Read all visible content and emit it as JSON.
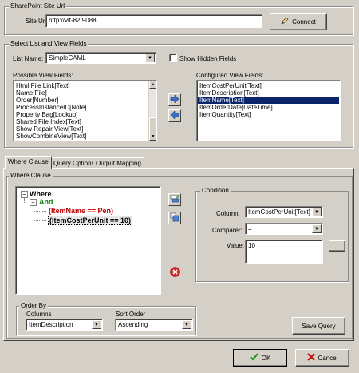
{
  "site_group": {
    "legend": "SharePoint Site Url",
    "site_url_label": "Site Url:",
    "site_url_value": "http://vlt-82:9088",
    "connect_label": "Connect"
  },
  "select_group": {
    "legend": "Select List and View Fields",
    "list_name_label": "List Name:",
    "list_name_value": "SimpleCAML",
    "show_hidden_label": "Show Hidden Fields",
    "possible_label": "Possible View Fields:",
    "configured_label": "Configured View Fields:",
    "possible_fields": [
      "Html File Link[Text]",
      "Name[File]",
      "Order[Number]",
      "ProcessInstanceID[Note]",
      "Property Bag[Lookup]",
      "Shared File Index[Text]",
      "Show Repair View[Text]",
      "ShowCombineView[Text]"
    ],
    "configured_fields": [
      "ItemCostPerUnit[Text]",
      "ItemDescription[Text]",
      "ItemName[Text]",
      "ItemOrderDate[DateTime]",
      "ItemQuantity[Text]"
    ],
    "configured_selected_index": 2
  },
  "tabs": [
    "Where Clause",
    "Query Options",
    "Output Mapping"
  ],
  "where_group": {
    "legend": "Where Clause",
    "tree": {
      "root": "Where",
      "op": "And",
      "cond1": "(ItemName == Pen)",
      "cond2": "(ItemCostPerUnit == 10)"
    },
    "condition": {
      "legend": "Condition",
      "column_label": "Column:",
      "column_value": "ItemCostPerUnit[Text]",
      "comparer_label": "Comparer:",
      "comparer_value": "=",
      "value_label": "Value:",
      "value_value": "10",
      "ellipsis_label": "..."
    },
    "order_by": {
      "legend": "Order By",
      "columns_label": "Columns",
      "columns_value": "ItemDescription",
      "sort_label": "Sort Order",
      "sort_value": "Ascending"
    },
    "save_query_label": "Save Query"
  },
  "footer": {
    "ok_label": "OK",
    "cancel_label": "Cancel"
  },
  "colors": {
    "tree_root": "#000000",
    "tree_and": "#008000",
    "tree_cond1": "#c00000",
    "selection": "#0a246a"
  }
}
